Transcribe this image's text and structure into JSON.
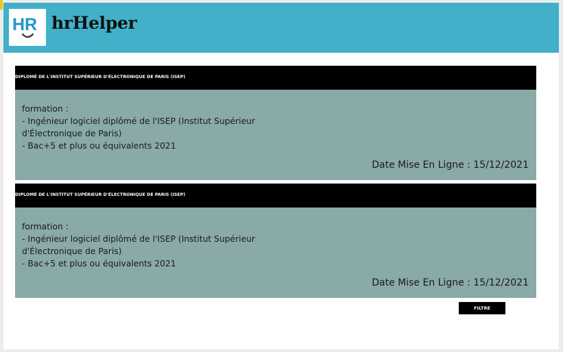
{
  "header": {
    "logo": {
      "icon": "hr-smile-logo-icon",
      "text": "HR"
    },
    "brand_name": "hrHelper",
    "color": "#42b0c9"
  },
  "cards": [
    {
      "title": "DIPLOMÉ DE L'INSTITUT SUPÉRIEUR D'ÉLECTRONIQUE DE PARIS (ISEP)",
      "lines": [
        "formation :",
        "- Ingénieur logiciel diplômé de l'ISEP (Institut Supérieur",
        "d'Électronique de Paris)",
        "- Bac+5 et plus ou équivalents 2021"
      ],
      "date": "Date Mise En Ligne : 15/12/2021"
    },
    {
      "title": "DIPLOMÉ DE L'INSTITUT SUPÉRIEUR D'ÉLECTRONIQUE DE PARIS (ISEP)",
      "lines": [
        "formation :",
        "- Ingénieur logiciel diplômé de l'ISEP (Institut Supérieur",
        "d'Électronique de Paris)",
        "- Bac+5 et plus ou équivalents 2021"
      ],
      "date": "Date Mise En Ligne : 15/12/2021"
    }
  ],
  "filter_button": {
    "label": "FILTRE"
  },
  "colors": {
    "card_background": "#8aa9a9",
    "title_bar": "#000000"
  }
}
